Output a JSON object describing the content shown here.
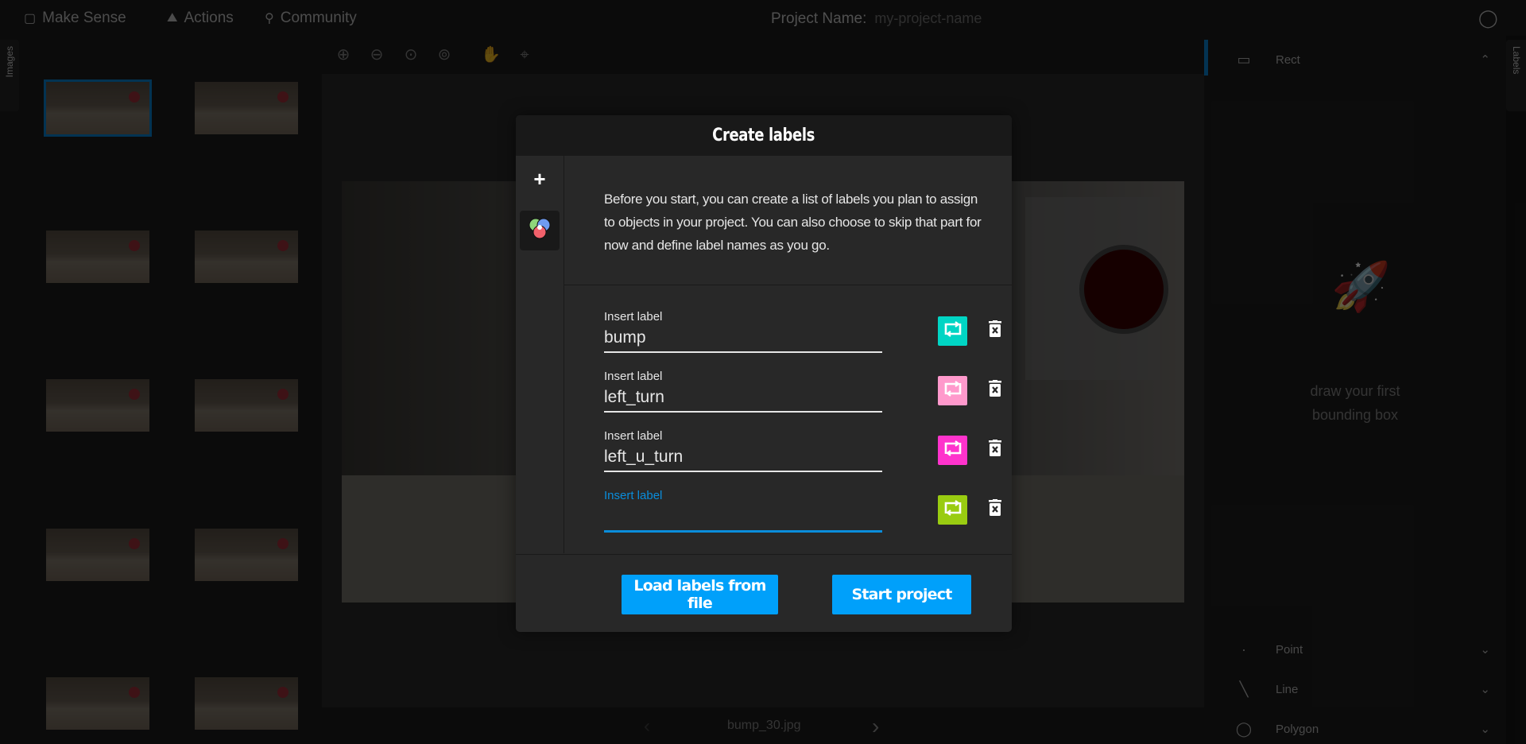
{
  "topbar": {
    "brand": "Make Sense",
    "actions": "Actions",
    "community": "Community",
    "project_name_label": "Project Name:",
    "project_name_value": "my-project-name",
    "github_icon": "github-icon"
  },
  "left_panel": {
    "tab_label": "Images",
    "thumbnails": [
      {
        "selected": true
      },
      {
        "selected": false
      },
      {
        "selected": false
      },
      {
        "selected": false
      },
      {
        "selected": false
      },
      {
        "selected": false
      },
      {
        "selected": false
      },
      {
        "selected": false
      },
      {
        "selected": false
      },
      {
        "selected": false
      }
    ]
  },
  "toolbar": {
    "tools": [
      "zoom-in-icon",
      "zoom-out-icon",
      "zoom-fit-icon",
      "zoom-max-icon",
      "hand-icon",
      "crosshair-icon"
    ]
  },
  "bottom_nav": {
    "prev": "‹",
    "filename": "bump_30.jpg",
    "next": "›"
  },
  "right_panel": {
    "tab_label": "Labels",
    "sections": [
      {
        "label": "Rect",
        "expanded": true
      },
      {
        "label": "Point",
        "expanded": false
      },
      {
        "label": "Line",
        "expanded": false
      },
      {
        "label": "Polygon",
        "expanded": false
      }
    ],
    "empty_text_1": "draw your first",
    "empty_text_2": "bounding box"
  },
  "modal": {
    "title": "Create labels",
    "description": "Before you start, you can create a list of labels you plan to assign to objects in your project. You can also choose to skip that part for now and define label names as you go.",
    "add_symbol": "+",
    "labels": [
      {
        "caption": "Insert label",
        "value": "bump",
        "color": "#00d5c4",
        "focused": false
      },
      {
        "caption": "Insert label",
        "value": "left_turn",
        "color": "#ff99cc",
        "focused": false
      },
      {
        "caption": "Insert label",
        "value": "left_u_turn",
        "color": "#ff33cc",
        "focused": false
      },
      {
        "caption": "Insert label",
        "value": "",
        "color": "#99cc11",
        "focused": true
      }
    ],
    "load_button": "Load labels from file",
    "start_button": "Start project"
  },
  "colors": {
    "accent": "#00a0fa",
    "focus": "#0a8ddb"
  }
}
